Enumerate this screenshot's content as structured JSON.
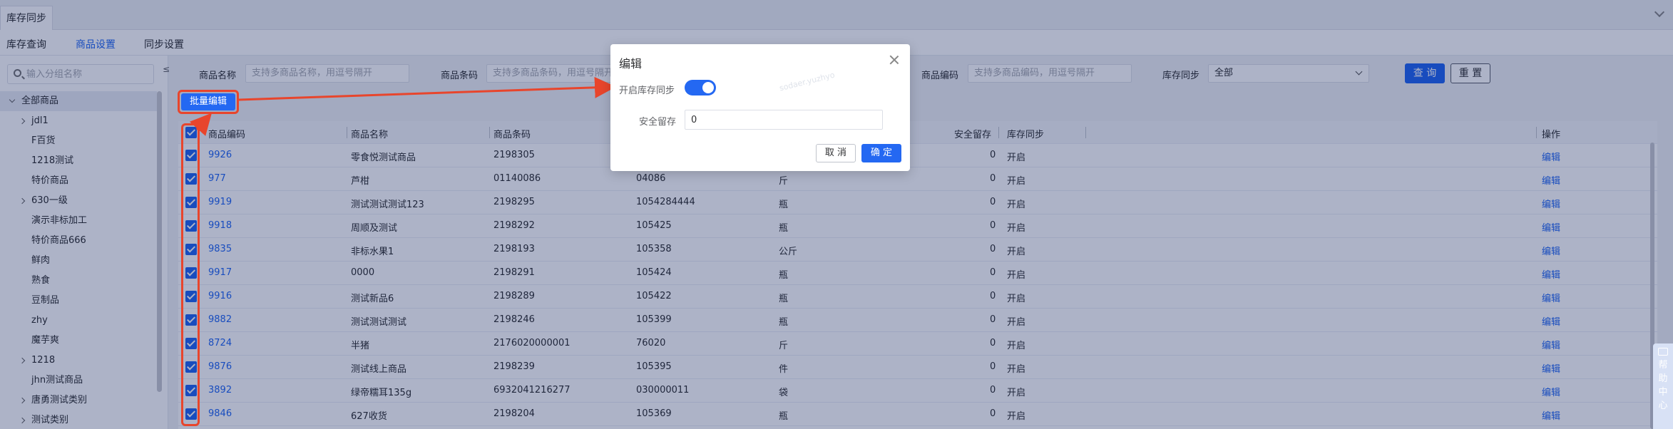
{
  "window": {
    "tab_label": "库存同步"
  },
  "page_tabs": [
    {
      "label": "库存查询",
      "active": false
    },
    {
      "label": "商品设置",
      "active": true
    },
    {
      "label": "同步设置",
      "active": false
    }
  ],
  "tree": {
    "search_placeholder": "输入分组名称",
    "collapse_label": "≤",
    "items": [
      {
        "label": "全部商品",
        "has_children": true,
        "expanded": true,
        "selected": true,
        "level": 0
      },
      {
        "label": "jdl1",
        "has_children": true,
        "level": 1
      },
      {
        "label": "F百货",
        "has_children": false,
        "level": 1
      },
      {
        "label": "1218测试",
        "has_children": false,
        "level": 1
      },
      {
        "label": "特价商品",
        "has_children": false,
        "level": 1
      },
      {
        "label": "630一级",
        "has_children": true,
        "level": 1
      },
      {
        "label": "演示非标加工",
        "has_children": false,
        "level": 1
      },
      {
        "label": "特价商品666",
        "has_children": false,
        "level": 1
      },
      {
        "label": "鲜肉",
        "has_children": false,
        "level": 1
      },
      {
        "label": "熟食",
        "has_children": false,
        "level": 1
      },
      {
        "label": "豆制品",
        "has_children": false,
        "level": 1
      },
      {
        "label": "zhy",
        "has_children": false,
        "level": 1
      },
      {
        "label": "魔芋爽",
        "has_children": false,
        "level": 1
      },
      {
        "label": "1218",
        "has_children": true,
        "level": 1
      },
      {
        "label": "jhn测试商品",
        "has_children": false,
        "level": 1
      },
      {
        "label": "唐勇测试类别",
        "has_children": true,
        "level": 1
      },
      {
        "label": "测试类别",
        "has_children": true,
        "level": 1
      }
    ]
  },
  "filters": {
    "name_label": "商品名称",
    "name_placeholder": "支持多商品名称，用逗号隔开",
    "barcode_label": "商品条码",
    "barcode_placeholder": "支持多商品条码，用逗号隔开",
    "code_label": "商品编码",
    "code_placeholder": "支持多商品编码，用逗号隔开",
    "sync_label": "库存同步",
    "sync_value": "全部",
    "query_button": "查 询",
    "reset_button": "重 置"
  },
  "batch_edit_button": "批量编辑",
  "table": {
    "columns": [
      "商品编码",
      "商品名称",
      "商品条码",
      "安全留存",
      "库存同步",
      "操作"
    ],
    "rows": [
      {
        "code": "9926",
        "name": "零食悦测试商品",
        "barcode": "2198305",
        "sku": "",
        "unit": "",
        "safety": "0",
        "sync": "开启",
        "action": "编辑"
      },
      {
        "code": "977",
        "name": "芦柑",
        "barcode": "01140086",
        "sku": "04086",
        "unit": "斤",
        "safety": "0",
        "sync": "开启",
        "action": "编辑"
      },
      {
        "code": "9919",
        "name": "测试测试测试123",
        "barcode": "2198295",
        "sku": "1054284444",
        "unit": "瓶",
        "safety": "0",
        "sync": "开启",
        "action": "编辑"
      },
      {
        "code": "9918",
        "name": "周顺及测试",
        "barcode": "2198292",
        "sku": "105425",
        "unit": "瓶",
        "safety": "0",
        "sync": "开启",
        "action": "编辑"
      },
      {
        "code": "9835",
        "name": "非标水果1",
        "barcode": "2198193",
        "sku": "105358",
        "unit": "公斤",
        "safety": "0",
        "sync": "开启",
        "action": "编辑"
      },
      {
        "code": "9917",
        "name": "0000",
        "barcode": "2198291",
        "sku": "105424",
        "unit": "瓶",
        "safety": "0",
        "sync": "开启",
        "action": "编辑"
      },
      {
        "code": "9916",
        "name": "测试新品6",
        "barcode": "2198289",
        "sku": "105422",
        "unit": "瓶",
        "safety": "0",
        "sync": "开启",
        "action": "编辑"
      },
      {
        "code": "9882",
        "name": "测试测试测试",
        "barcode": "2198246",
        "sku": "105399",
        "unit": "瓶",
        "safety": "0",
        "sync": "开启",
        "action": "编辑"
      },
      {
        "code": "8724",
        "name": "半猪",
        "barcode": "2176020000001",
        "sku": "76020",
        "unit": "斤",
        "safety": "0",
        "sync": "开启",
        "action": "编辑"
      },
      {
        "code": "9876",
        "name": "测试线上商品",
        "barcode": "2198239",
        "sku": "105395",
        "unit": "件",
        "safety": "0",
        "sync": "开启",
        "action": "编辑"
      },
      {
        "code": "3892",
        "name": "绿帝糯耳135g",
        "barcode": "6932041216277",
        "sku": "030000011",
        "unit": "袋",
        "safety": "0",
        "sync": "开启",
        "action": "编辑"
      },
      {
        "code": "9846",
        "name": "627收货",
        "barcode": "2198204",
        "sku": "105369",
        "unit": "瓶",
        "safety": "0",
        "sync": "开启",
        "action": "编辑"
      }
    ]
  },
  "modal": {
    "title": "编辑",
    "sync_label": "开启库存同步",
    "sync_enabled": true,
    "safety_label": "安全留存",
    "safety_value": "0",
    "cancel_button": "取 消",
    "confirm_button": "确 定",
    "watermark": "sodaer.yuzhyo"
  },
  "help_widget": {
    "chars": [
      "帮",
      "助",
      "中",
      "心"
    ]
  },
  "colors": {
    "primary": "#2468f2",
    "annotation": "#e8452c"
  }
}
